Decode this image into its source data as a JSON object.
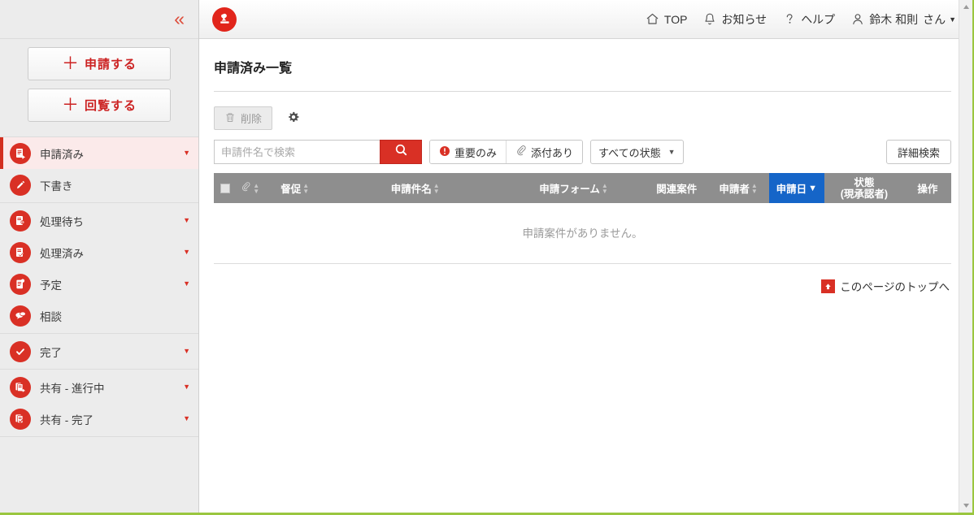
{
  "sidebar": {
    "collapse_label": "«",
    "action_buttons": [
      {
        "label": "申請する",
        "plus": "＋",
        "name": "apply-button"
      },
      {
        "label": "回覧する",
        "plus": "＋",
        "name": "circulate-button"
      }
    ],
    "groups": [
      {
        "items": [
          {
            "label": "申請済み",
            "icon": "document-arrow-icon",
            "caret": "▼",
            "active": true
          },
          {
            "label": "下書き",
            "icon": "pencil-icon",
            "caret": "",
            "active": false
          }
        ]
      },
      {
        "items": [
          {
            "label": "処理待ち",
            "icon": "document-person-icon",
            "caret": "▼",
            "active": false
          },
          {
            "label": "処理済み",
            "icon": "document-check-icon",
            "caret": "▼",
            "active": false
          },
          {
            "label": "予定",
            "icon": "document-dot-icon",
            "caret": "▼",
            "active": false
          },
          {
            "label": "相談",
            "icon": "speech-bubble-icon",
            "caret": "",
            "active": false
          }
        ]
      },
      {
        "items": [
          {
            "label": "完了",
            "icon": "check-circle-icon",
            "caret": "▼",
            "active": false
          }
        ]
      },
      {
        "items": [
          {
            "label": "共有 - 進行中",
            "icon": "documents-arrow-icon",
            "caret": "▼",
            "active": false
          },
          {
            "label": "共有 - 完了",
            "icon": "documents-check-icon",
            "caret": "▼",
            "active": false
          }
        ]
      }
    ]
  },
  "header": {
    "logo_name": "stamp-logo-icon",
    "links": [
      {
        "label": "TOP",
        "icon": "home-icon",
        "name": "top-link"
      },
      {
        "label": "お知らせ",
        "icon": "bell-icon",
        "name": "notices-link"
      },
      {
        "label": "ヘルプ",
        "icon": "question-icon",
        "name": "help-link"
      }
    ],
    "user": {
      "name": "鈴木 和則",
      "suffix": "さん",
      "caret": "▼",
      "icon": "person-icon"
    }
  },
  "page": {
    "title": "申請済み一覧"
  },
  "toolbar": {
    "delete_label": "削除",
    "delete_icon": "trash-icon",
    "settings_icon": "gear-icon"
  },
  "search": {
    "placeholder": "申請件名で検索",
    "value": "",
    "search_icon": "magnifier-icon",
    "filters": [
      {
        "label": "重要のみ",
        "icon": "important-icon"
      },
      {
        "label": "添付あり",
        "icon": "paperclip-icon"
      }
    ],
    "state_select": {
      "value": "すべての状態",
      "caret": "▼"
    },
    "detail_button": "詳細検索"
  },
  "table": {
    "columns": [
      {
        "label": "",
        "kind": "checkbox",
        "name": "select-all-checkbox",
        "sortable": false,
        "sorted": false
      },
      {
        "label": "",
        "kind": "paperclip",
        "name": "attachment-column",
        "sortable": true,
        "sorted": false
      },
      {
        "label": "督促",
        "kind": "text",
        "name": "reminder-column",
        "sortable": true,
        "sorted": false
      },
      {
        "label": "申請件名",
        "kind": "text",
        "name": "subject-column",
        "sortable": true,
        "sorted": false
      },
      {
        "label": "申請フォーム",
        "kind": "text",
        "name": "form-column",
        "sortable": true,
        "sorted": false
      },
      {
        "label": "関連案件",
        "kind": "text",
        "name": "related-case-column",
        "sortable": false,
        "sorted": false
      },
      {
        "label": "申請者",
        "kind": "text",
        "name": "applicant-column",
        "sortable": true,
        "sorted": false
      },
      {
        "label": "申請日",
        "kind": "text",
        "name": "apply-date-column",
        "sortable": true,
        "sorted": true,
        "sort_dir": "desc"
      },
      {
        "label": "状態",
        "label2": "(現承認者)",
        "kind": "two-line",
        "name": "status-column",
        "sortable": false,
        "sorted": false
      },
      {
        "label": "操作",
        "kind": "text",
        "name": "actions-column",
        "sortable": false,
        "sorted": false
      }
    ],
    "rows": [],
    "empty_message": "申請案件がありません。"
  },
  "footer": {
    "back_to_top": "このページのトップへ",
    "back_to_top_icon": "arrow-up-icon"
  },
  "colors": {
    "brand_red": "#d93025",
    "sorted_blue": "#1565c8",
    "header_grey": "#8e8e8e",
    "accent_green": "#9ac63f"
  }
}
